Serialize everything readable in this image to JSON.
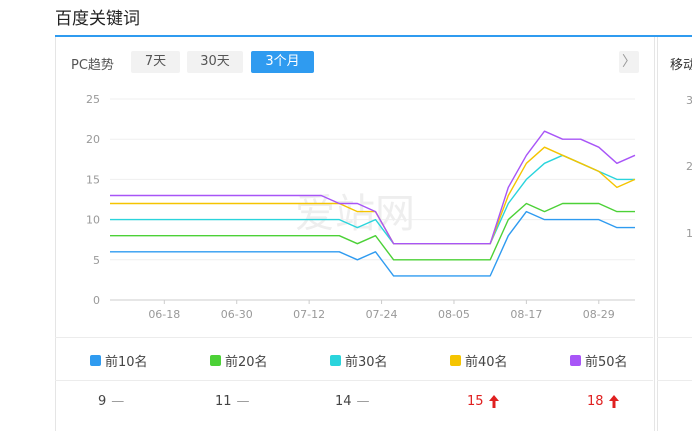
{
  "section_title": "百度关键词",
  "trend_label": "PC趋势",
  "tabs": [
    {
      "label": "7天",
      "active": false
    },
    {
      "label": "30天",
      "active": false
    },
    {
      "label": "3个月",
      "active": true
    }
  ],
  "next_arrow": "〉",
  "side_panel": {
    "title": "移动",
    "ticks": [
      "3",
      "2",
      "1"
    ]
  },
  "chart_data": {
    "type": "line",
    "ylim": [
      0,
      25
    ],
    "yticks": [
      "0",
      "5",
      "10",
      "15",
      "20",
      "25"
    ],
    "xticks": [
      "06-18",
      "06-30",
      "07-12",
      "07-24",
      "08-05",
      "08-17",
      "08-29"
    ],
    "x": [
      "06-09",
      "06-16",
      "06-23",
      "06-30",
      "07-07",
      "07-14",
      "07-17",
      "07-20",
      "07-23",
      "07-26",
      "07-29",
      "08-05",
      "08-08",
      "08-11",
      "08-14",
      "08-17",
      "08-20",
      "08-23",
      "08-26",
      "08-29",
      "09-01",
      "09-04"
    ],
    "series": [
      {
        "name": "前10名",
        "color": "#2f9bf0",
        "values": [
          6,
          6,
          6,
          6,
          6,
          6,
          6,
          5,
          6,
          3,
          3,
          3,
          3,
          3,
          8,
          11,
          10,
          10,
          10,
          10,
          9,
          9
        ]
      },
      {
        "name": "前20名",
        "color": "#4cd137",
        "values": [
          8,
          8,
          8,
          8,
          8,
          8,
          8,
          7,
          8,
          5,
          5,
          5,
          5,
          5,
          10,
          12,
          11,
          12,
          12,
          12,
          11,
          11
        ]
      },
      {
        "name": "前30名",
        "color": "#2ad4dc",
        "values": [
          10,
          10,
          10,
          10,
          10,
          10,
          10,
          9,
          10,
          7,
          7,
          7,
          7,
          7,
          12,
          15,
          17,
          18,
          17,
          16,
          15,
          15
        ]
      },
      {
        "name": "前40名",
        "color": "#f5c400",
        "values": [
          12,
          12,
          12,
          12,
          12,
          12,
          12,
          11,
          11,
          7,
          7,
          7,
          7,
          7,
          13,
          17,
          19,
          18,
          17,
          16,
          14,
          15
        ]
      },
      {
        "name": "前50名",
        "color": "#a855f7",
        "values": [
          13,
          13,
          13,
          13,
          13,
          13,
          12,
          12,
          11,
          7,
          7,
          7,
          7,
          7,
          14,
          18,
          21,
          20,
          20,
          19,
          17,
          18
        ]
      }
    ]
  },
  "values": [
    {
      "value": "9",
      "trend": "flat"
    },
    {
      "value": "11",
      "trend": "flat"
    },
    {
      "value": "14",
      "trend": "flat"
    },
    {
      "value": "15",
      "trend": "up"
    },
    {
      "value": "18",
      "trend": "up"
    }
  ],
  "watermark": "爱站网"
}
